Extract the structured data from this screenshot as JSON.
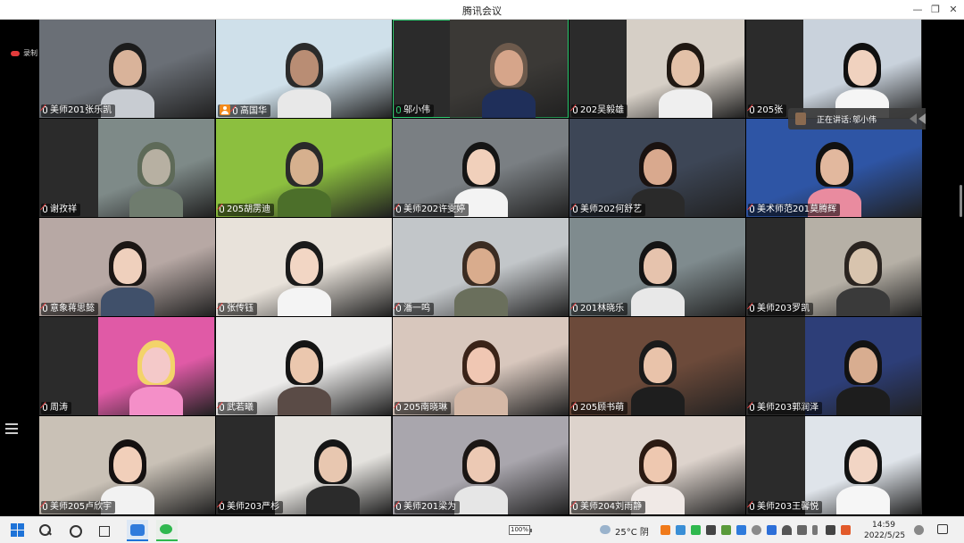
{
  "window": {
    "title": "腾讯会议",
    "controls": {
      "minimize": "—",
      "restore": "❐",
      "close": "✕"
    }
  },
  "toolbar": {
    "recording_label": "录制"
  },
  "speaking": {
    "label": "正在讲话:",
    "name": "邬小伟"
  },
  "participants": [
    {
      "name": "美师201张乐凯",
      "mic": "muted",
      "bg": "#6a6f76",
      "skin": "#d9b39a",
      "hair": "#1c1c1c",
      "shirt": "#c8ccd2"
    },
    {
      "name": "高国华",
      "mic": "muted",
      "host": true,
      "bg": "#cfe0ea",
      "skin": "#b98d74",
      "hair": "#2b2b2b",
      "shirt": "#e8e8e8"
    },
    {
      "name": "邬小伟",
      "mic": "on",
      "active": true,
      "bg": "#3b3936",
      "skin": "#d6a58a",
      "hair": "#6d5a4c",
      "shirt": "#1f2f5a"
    },
    {
      "name": "202吴毅雄",
      "mic": "muted",
      "bg": "#d6cfc6",
      "skin": "#e3c1a8",
      "hair": "#201812",
      "shirt": "#efefef"
    },
    {
      "name": "205张",
      "mic": "muted",
      "bg": "#c9d2dc",
      "skin": "#f0d2bf",
      "hair": "#101010",
      "shirt": "#f5f5f5"
    },
    {
      "name": "谢孜祥",
      "mic": "muted",
      "bg": "#7e8a88",
      "skin": "#b7b0a2",
      "hair": "#5e6a58",
      "shirt": "#6f7c6e"
    },
    {
      "name": "205胡雳迪",
      "mic": "muted",
      "bg": "#8cbf3f",
      "skin": "#d6b08e",
      "hair": "#2a2a2a",
      "shirt": "#4c6f2a"
    },
    {
      "name": "美师202许雯婷",
      "mic": "muted",
      "bg": "#7a7f83",
      "skin": "#f1d0bb",
      "hair": "#151515",
      "shirt": "#f3f3f3"
    },
    {
      "name": "美师202何舒艺",
      "mic": "muted",
      "bg": "#3d4656",
      "skin": "#d9a98e",
      "hair": "#1a1210",
      "shirt": "#2a2a2a"
    },
    {
      "name": "美术师范201莫腾辉",
      "mic": "muted",
      "bg": "#2e55a5",
      "skin": "#e2b89e",
      "hair": "#111111",
      "shirt": "#e98b9f"
    },
    {
      "name": "意象蒋思懿",
      "mic": "muted",
      "bg": "#b7a8a4",
      "skin": "#efd0bd",
      "hair": "#1b1614",
      "shirt": "#40506a"
    },
    {
      "name": "张传钰",
      "mic": "muted",
      "bg": "#e8e2da",
      "skin": "#f2d6c4",
      "hair": "#1a1a1a",
      "shirt": "#f4f4f4"
    },
    {
      "name": "潘一鸣",
      "mic": "muted",
      "bg": "#c2c6c9",
      "skin": "#d9ac8d",
      "hair": "#3b2c22",
      "shirt": "#6a6f5c"
    },
    {
      "name": "201林晓乐",
      "mic": "muted",
      "bg": "#7f8b8e",
      "skin": "#e6c3ad",
      "hair": "#141414",
      "shirt": "#e8e8e8"
    },
    {
      "name": "美师203罗凯",
      "mic": "muted",
      "bg": "#b6b0a6",
      "skin": "#d8c4ae",
      "hair": "#2a2420",
      "shirt": "#3a3a3a"
    },
    {
      "name": "周涛",
      "mic": "muted",
      "bg": "#e05aa6",
      "skin": "#f4c9c9",
      "hair": "#f3d36a",
      "shirt": "#f48fc8"
    },
    {
      "name": "武若曦",
      "mic": "muted",
      "bg": "#ecebea",
      "skin": "#ebc7ae",
      "hair": "#141414",
      "shirt": "#5a4b46"
    },
    {
      "name": "205南晓琳",
      "mic": "muted",
      "bg": "#d8c7bd",
      "skin": "#f0c7b3",
      "hair": "#3a2318",
      "shirt": "#d5b8a6"
    },
    {
      "name": "205顾书萌",
      "mic": "muted",
      "bg": "#6c4a3a",
      "skin": "#e9c3aa",
      "hair": "#1a1a1a",
      "shirt": "#1e1e1e"
    },
    {
      "name": "美师203郭润泽",
      "mic": "muted",
      "bg": "#2d3e78",
      "skin": "#d8ad90",
      "hair": "#121212",
      "shirt": "#1d1d1d"
    },
    {
      "name": "美师205卢欣宇",
      "mic": "muted",
      "bg": "#c9c1b6",
      "skin": "#f1cfba",
      "hair": "#141010",
      "shirt": "#f2f2f2"
    },
    {
      "name": "美师203严杉",
      "mic": "muted",
      "bg": "#e4e2de",
      "skin": "#e8c7b0",
      "hair": "#161616",
      "shirt": "#2b2b2b"
    },
    {
      "name": "美师201梁为",
      "mic": "muted",
      "bg": "#a9a6ad",
      "skin": "#ecc9b4",
      "hair": "#1b1614",
      "shirt": "#e6e6e6"
    },
    {
      "name": "美师204刘雨静",
      "mic": "muted",
      "bg": "#ddd3cc",
      "skin": "#eec8b0",
      "hair": "#2b1a12",
      "shirt": "#f0e9e6"
    },
    {
      "name": "美师203王馨悦",
      "mic": "muted",
      "bg": "#dfe4ea",
      "skin": "#f2d5c4",
      "hair": "#121212",
      "shirt": "#f6f6f6"
    }
  ],
  "taskbar": {
    "battery": "100%",
    "weather": "25°C 阴",
    "time": "14:59",
    "date": "2022/5/25"
  },
  "colors": {
    "active_speaker": "#2ecc71",
    "host_badge": "#f28b1c",
    "muted_mic": "#e04040"
  }
}
